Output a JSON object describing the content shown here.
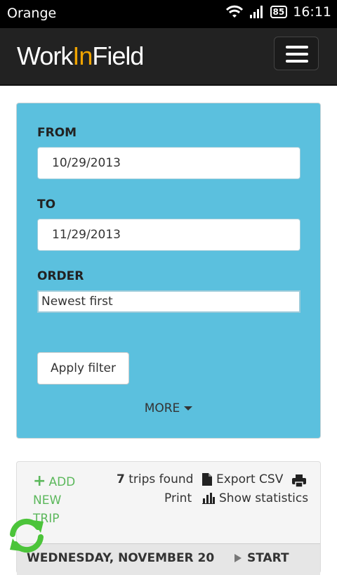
{
  "status": {
    "carrier": "Orange",
    "battery": "85",
    "time": "16:11"
  },
  "navbar": {
    "brand_prefix": "Work",
    "brand_accent": "In",
    "brand_suffix": "Field"
  },
  "filter": {
    "from_label": "FROM",
    "from_value": "10/29/2013",
    "to_label": "TO",
    "to_value": "11/29/2013",
    "order_label": "ORDER",
    "order_value": "Newest first",
    "apply_label": "Apply filter",
    "more_label": "MORE"
  },
  "results": {
    "add_trip_label": "ADD NEW TRIP",
    "trip_count": "7",
    "trips_found_text": "trips found",
    "export_label": "Export CSV",
    "print_label": "Print",
    "stats_label": "Show statistics",
    "day_title": "WEDNESDAY, NOVEMBER 20",
    "start_label": "START"
  },
  "colors": {
    "panel": "#5bc0de",
    "accent_green": "#5cb85c",
    "brand_orange": "#f0a400",
    "navbar": "#222222"
  }
}
